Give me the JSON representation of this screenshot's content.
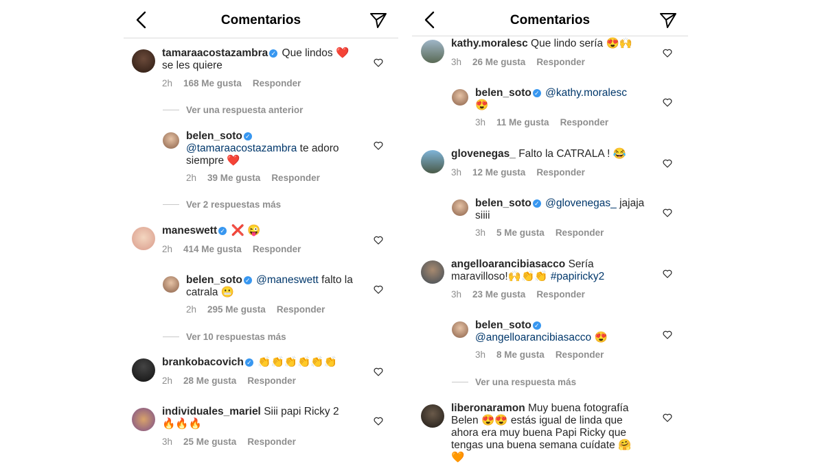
{
  "left": {
    "title": "Comentarios",
    "comments": [
      {
        "user": "tamaraacostazambra",
        "verified": true,
        "text": "Que lindos ❤️",
        "text2": "se les quiere",
        "time": "2h",
        "likes": "168 Me gusta",
        "reply": "Responder"
      },
      {
        "more": "Ver una respuesta anterior"
      },
      {
        "user": "belen_soto",
        "verified": true,
        "mention": "@tamaraacostazambra",
        "text": "te adoro",
        "text2": "siempre ❤️",
        "time": "2h",
        "likes": "39 Me gusta",
        "reply": "Responder"
      },
      {
        "more": "Ver 2 respuestas más"
      },
      {
        "user": "maneswett",
        "verified": true,
        "text": "❌ 😜",
        "time": "2h",
        "likes": "414 Me gusta",
        "reply": "Responder"
      },
      {
        "user": "belen_soto",
        "verified": true,
        "mention": "@maneswett",
        "text": "falto la",
        "text2": "catrala 😬",
        "time": "2h",
        "likes": "295 Me gusta",
        "reply": "Responder"
      },
      {
        "more": "Ver 10 respuestas más"
      },
      {
        "user": "brankobacovich",
        "verified": true,
        "text": "👏👏👏👏👏👏",
        "time": "2h",
        "likes": "28 Me gusta",
        "reply": "Responder"
      },
      {
        "user": "individuales_mariel",
        "verified": false,
        "text": "Siii papi Ricky 2",
        "text2": "🔥🔥🔥",
        "time": "3h",
        "likes": "25 Me gusta",
        "reply": "Responder"
      }
    ]
  },
  "right": {
    "title": "Comentarios",
    "comments": [
      {
        "user": "kathy.moralesc",
        "verified": false,
        "text": "Que lindo sería 😍🙌",
        "time": "3h",
        "likes": "26 Me gusta",
        "reply": "Responder"
      },
      {
        "user": "belen_soto",
        "verified": true,
        "mention": "@kathy.moralesc",
        "text2": "😍",
        "time": "3h",
        "likes": "11 Me gusta",
        "reply": "Responder"
      },
      {
        "user": "glovenegas_",
        "verified": false,
        "text": "Falto la CATRALA ! 😂",
        "time": "3h",
        "likes": "12 Me gusta",
        "reply": "Responder"
      },
      {
        "user": "belen_soto",
        "verified": true,
        "mention": "@glovenegas_",
        "text": "jajaja",
        "text2": "siiii",
        "time": "3h",
        "likes": "5 Me gusta",
        "reply": "Responder"
      },
      {
        "user": "angelloarancibiasacco",
        "verified": false,
        "text": "Sería",
        "text2": "maravilloso!🙌👏👏",
        "hashtag": "#papiricky2",
        "time": "3h",
        "likes": "23 Me gusta",
        "reply": "Responder"
      },
      {
        "user": "belen_soto",
        "verified": true,
        "mention2": "@angelloarancibiasacco",
        "text2": "😍",
        "time": "3h",
        "likes": "8 Me gusta",
        "reply": "Responder"
      },
      {
        "more": "Ver una respuesta más"
      },
      {
        "user": "liberonaramon",
        "verified": false,
        "text": "Muy buena fotografía",
        "text2": "Belen 😍😍 estás igual de linda que",
        "text3": "ahora era muy buena Papi Ricky que",
        "text4": "tengas una buena semana cuídate 🤗",
        "text5": "🧡"
      }
    ]
  },
  "colors": {
    "text": "#262626",
    "muted": "#8e8e8e",
    "mention": "#00376b",
    "verified": "#3897f0",
    "divider": "#dbdbdb"
  },
  "icons": {
    "back": "chevron-left-icon",
    "send": "paper-plane-icon",
    "like": "heart-outline-icon",
    "verified": "verified-badge-icon"
  }
}
